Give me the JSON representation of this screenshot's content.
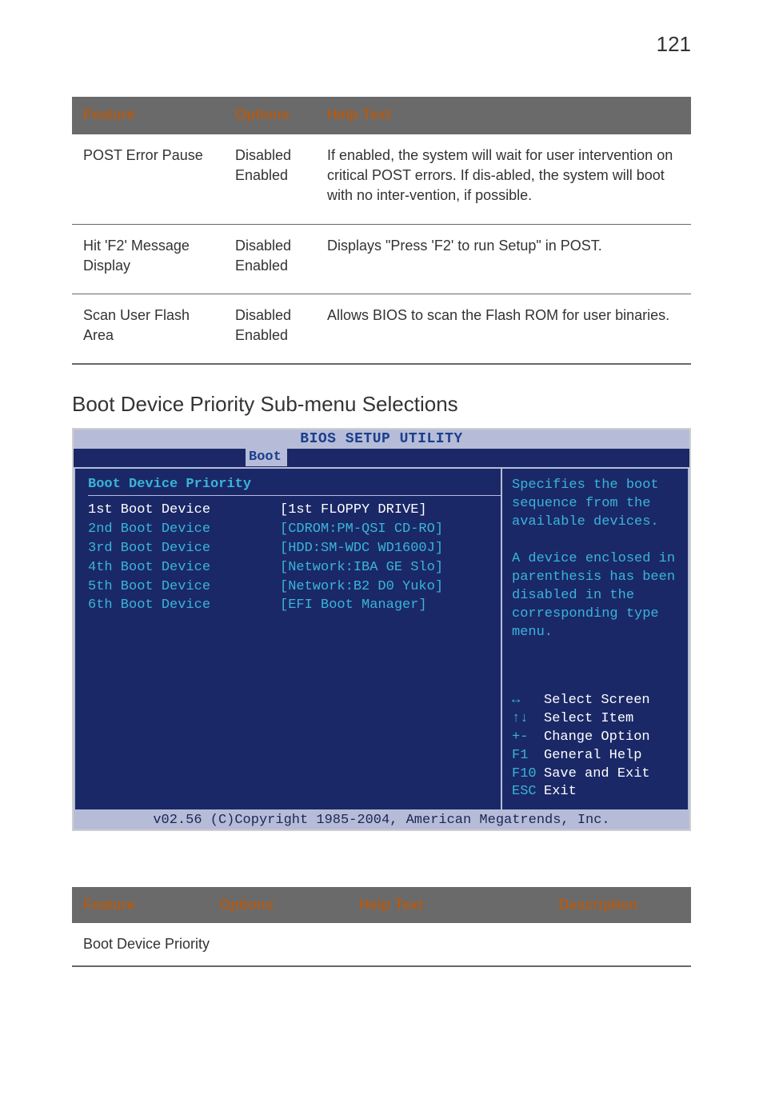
{
  "page_number": "121",
  "table1": {
    "headers": {
      "feature": "Feature",
      "options": "Options",
      "help": "Help Text"
    },
    "rows": [
      {
        "feature": "POST Error Pause",
        "options": "Disabled\nEnabled",
        "help": "If enabled, the system will wait for user intervention on critical POST errors. If dis-abled, the system will boot with no inter-vention, if possible."
      },
      {
        "feature": "Hit 'F2' Message Display",
        "options": "Disabled\nEnabled",
        "help": "Displays \"Press 'F2' to run Setup\" in POST."
      },
      {
        "feature": "Scan User Flash Area",
        "options": "Disabled\nEnabled",
        "help": "Allows BIOS to scan the Flash ROM for user binaries."
      }
    ]
  },
  "section_title": "Boot Device Priority Sub-menu Selections",
  "bios": {
    "utility_title": "BIOS SETUP UTILITY",
    "tab": "Boot",
    "left_heading": "Boot Device Priority",
    "devices": [
      {
        "label": "1st Boot Device",
        "value": "[1st FLOPPY DRIVE]",
        "selected": true
      },
      {
        "label": "2nd Boot Device",
        "value": "[CDROM:PM-QSI CD-RO]",
        "selected": false
      },
      {
        "label": "3rd Boot Device",
        "value": "[HDD:SM-WDC WD1600J]",
        "selected": false
      },
      {
        "label": "4th Boot Device",
        "value": "[Network:IBA GE Slo]",
        "selected": false
      },
      {
        "label": "5th Boot Device",
        "value": "[Network:B2 D0 Yuko]",
        "selected": false
      },
      {
        "label": "6th Boot Device",
        "value": "[EFI Boot Manager]",
        "selected": false
      }
    ],
    "help_lines": [
      "Specifies the boot",
      "sequence from the",
      "available devices.",
      "",
      "A device enclosed in",
      "parenthesis has been",
      "disabled in the",
      "corresponding type",
      "menu."
    ],
    "nav": [
      {
        "key": "↔",
        "act": "Select Screen"
      },
      {
        "key": "↑↓",
        "act": "Select Item"
      },
      {
        "key": "+-",
        "act": "Change Option"
      },
      {
        "key": "F1",
        "act": "General Help"
      },
      {
        "key": "F10",
        "act": "Save and Exit"
      },
      {
        "key": "ESC",
        "act": "Exit"
      }
    ],
    "footer": "v02.56 (C)Copyright 1985-2004, American Megatrends, Inc."
  },
  "table2": {
    "headers": {
      "feature": "Feature",
      "options": "Options",
      "help": "Help Text",
      "desc": "Description"
    },
    "row_label": "Boot Device Priority"
  }
}
